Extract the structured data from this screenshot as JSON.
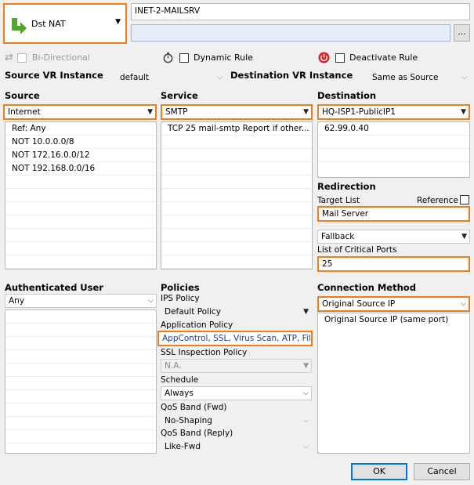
{
  "rule": {
    "type_label": "Dst NAT",
    "name": "INET-2-MAILSRV",
    "description": "",
    "more_label": "..."
  },
  "options": {
    "bidirectional_label": "Bi-Directional",
    "dynamic_rule_label": "Dynamic Rule",
    "deactivate_rule_label": "Deactivate Rule"
  },
  "vr": {
    "source_label": "Source VR Instance",
    "source_value": "default",
    "dest_label": "Destination VR Instance",
    "dest_value": "Same as Source"
  },
  "source": {
    "title": "Source",
    "selected": "Internet",
    "items": [
      "Ref: Any",
      "NOT 10.0.0.0/8",
      "NOT 172.16.0.0/12",
      "NOT 192.168.0.0/16"
    ]
  },
  "service": {
    "title": "Service",
    "selected": "SMTP",
    "items": [
      "TCP  25 mail-smtp  Report if other..."
    ]
  },
  "destination": {
    "title": "Destination",
    "selected": "HQ-ISP1-PublicIP1",
    "items": [
      "62.99.0.40"
    ]
  },
  "redirection": {
    "title": "Redirection",
    "target_list_label": "Target List",
    "reference_label": "Reference",
    "target_value": "Mail Server",
    "fallback_value": "Fallback",
    "critical_ports_label": "List of Critical Ports",
    "critical_ports_value": "25"
  },
  "auth_user": {
    "title": "Authenticated User",
    "selected": "Any"
  },
  "policies": {
    "title": "Policies",
    "ips_label": "IPS Policy",
    "ips_value": "Default Policy",
    "app_label": "Application Policy",
    "app_value": "AppControl, SSL, Virus Scan, ATP, File...",
    "ssl_label": "SSL Inspection Policy",
    "ssl_value": "N.A.",
    "schedule_label": "Schedule",
    "schedule_value": "Always",
    "qos_fwd_label": "QoS Band (Fwd)",
    "qos_fwd_value": "No-Shaping",
    "qos_reply_label": "QoS Band (Reply)",
    "qos_reply_value": "Like-Fwd"
  },
  "connection": {
    "title": "Connection Method",
    "selected": "Original Source IP",
    "items": [
      "Original Source IP (same port)"
    ]
  },
  "buttons": {
    "ok": "OK",
    "cancel": "Cancel"
  },
  "colors": {
    "highlight": "#f07c1c",
    "arrow_green": "#4caa2a",
    "link_blue": "#1a3fa8",
    "deactivate_red": "#e02020",
    "ok_border": "#0078d7"
  }
}
